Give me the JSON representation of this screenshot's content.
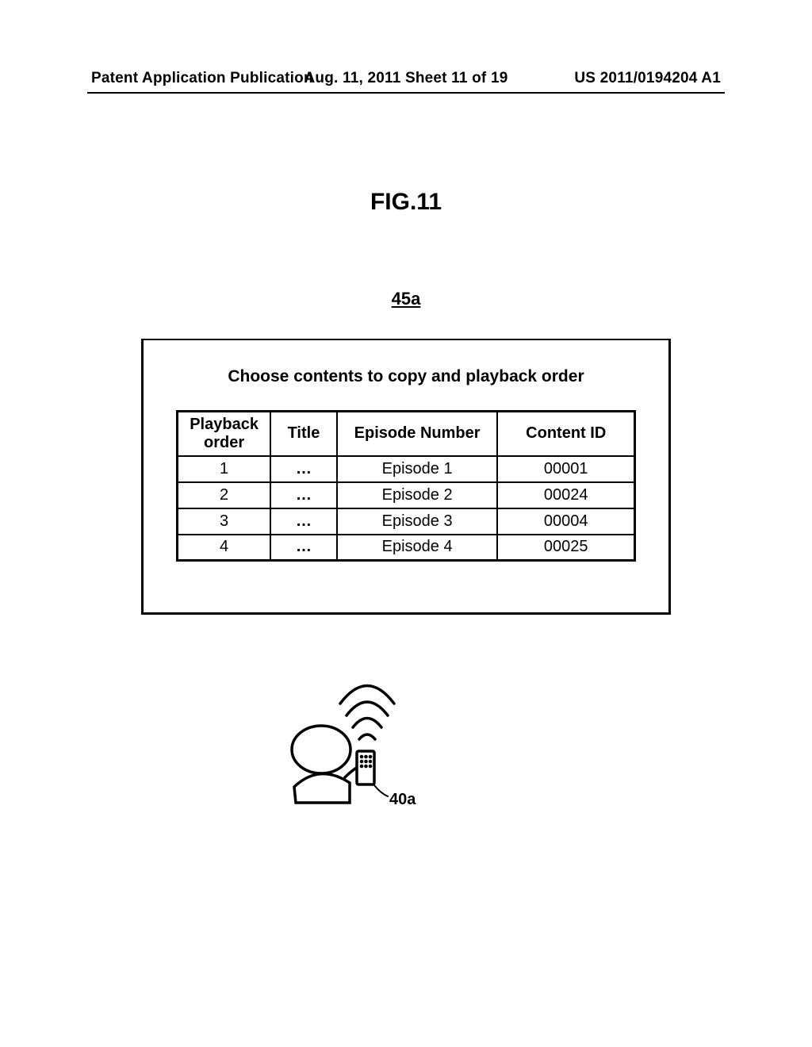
{
  "header": {
    "left": "Patent Application Publication",
    "center": "Aug. 11, 2011  Sheet 11 of 19",
    "right": "US 2011/0194204 A1"
  },
  "figure": {
    "label": "FIG.11",
    "ref": "45a",
    "device_ref": "40a"
  },
  "screen": {
    "title": "Choose contents to copy and playback order",
    "headers": {
      "playback_order": "Playback\norder",
      "title": "Title",
      "episode_number": "Episode Number",
      "content_id": "Content ID"
    },
    "rows": [
      {
        "order": "1",
        "title": "…",
        "episode": "Episode 1",
        "content_id": "00001"
      },
      {
        "order": "2",
        "title": "…",
        "episode": "Episode 2",
        "content_id": "00024"
      },
      {
        "order": "3",
        "title": "…",
        "episode": "Episode 3",
        "content_id": "00004"
      },
      {
        "order": "4",
        "title": "…",
        "episode": "Episode 4",
        "content_id": "00025"
      }
    ]
  }
}
